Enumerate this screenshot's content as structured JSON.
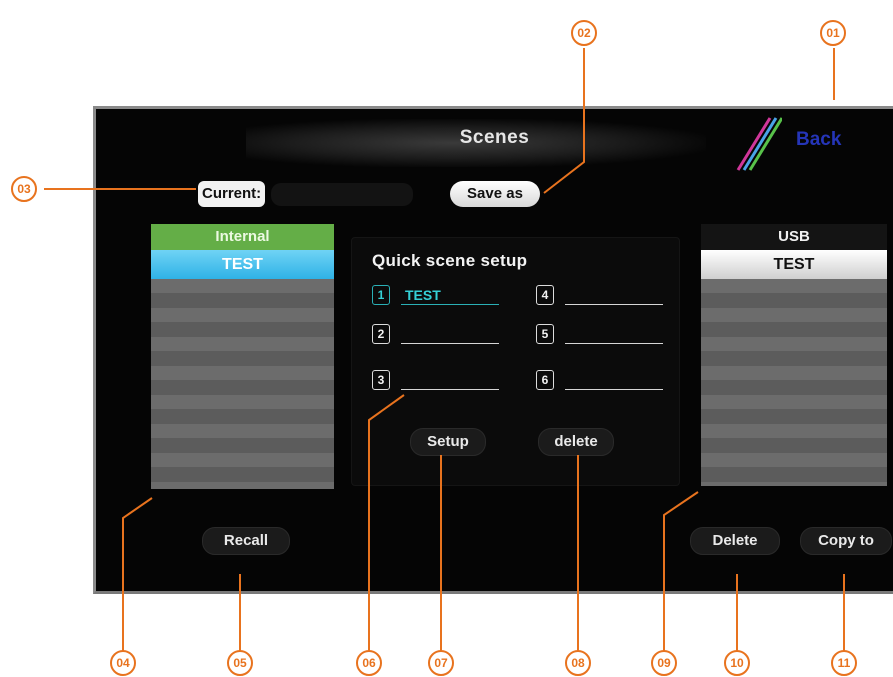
{
  "screen": {
    "title": "Scenes",
    "back_label": "Back",
    "current_label": "Current:",
    "current_value": "",
    "save_as_label": "Save as"
  },
  "internal_list": {
    "header": "Internal",
    "selected_item": "TEST"
  },
  "usb_list": {
    "header": "USB",
    "selected_item": "TEST"
  },
  "quick_scene": {
    "title": "Quick scene setup",
    "slots": [
      {
        "num": "1",
        "name": "TEST"
      },
      {
        "num": "2",
        "name": ""
      },
      {
        "num": "3",
        "name": ""
      },
      {
        "num": "4",
        "name": ""
      },
      {
        "num": "5",
        "name": ""
      },
      {
        "num": "6",
        "name": ""
      }
    ],
    "setup_label": "Setup",
    "delete_label": "delete"
  },
  "buttons": {
    "recall_label": "Recall",
    "delete_label": "Delete",
    "copy_to_label": "Copy to"
  },
  "callouts": [
    "01",
    "02",
    "03",
    "04",
    "05",
    "06",
    "07",
    "08",
    "09",
    "10",
    "11"
  ],
  "colors": {
    "callout": "#e8731e",
    "internal_header": "#64ae47",
    "selected_blue": "#2fb2e6",
    "quick_active": "#35d0d6",
    "back_text": "#2535b8"
  }
}
